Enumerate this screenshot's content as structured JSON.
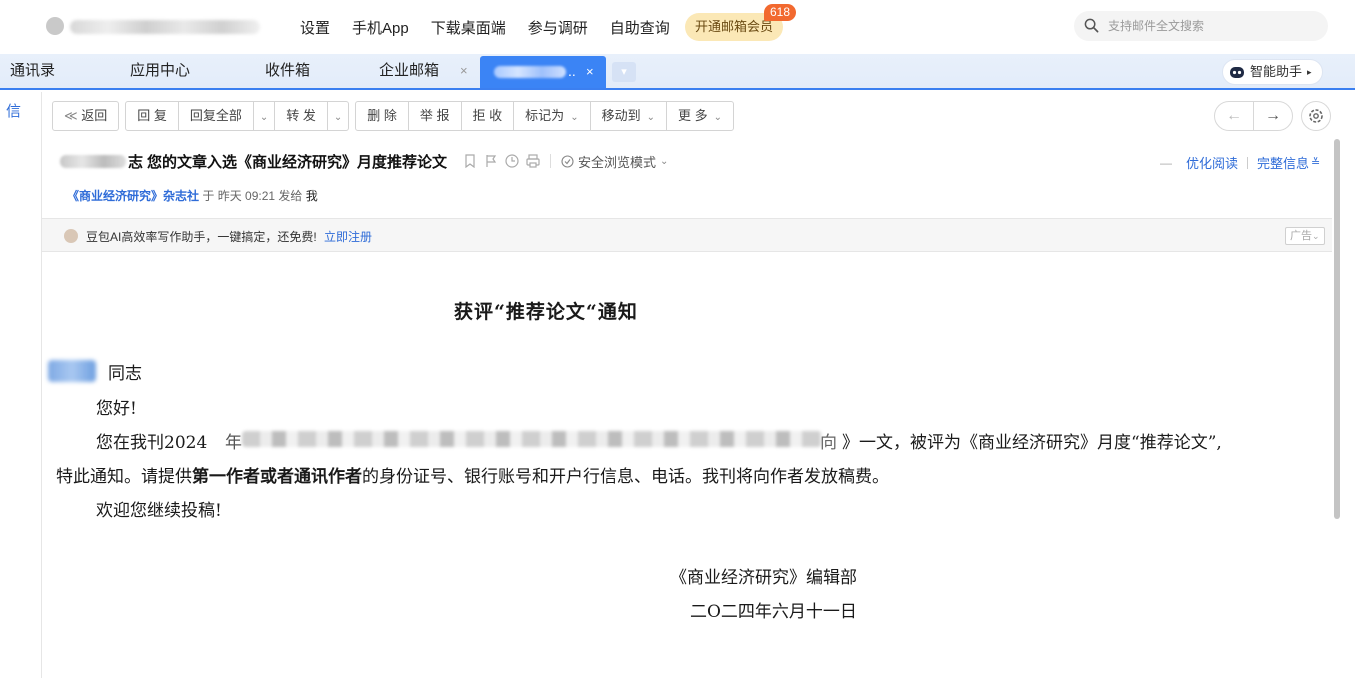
{
  "topbar": {
    "nav": [
      "设置",
      "手机App",
      "下载桌面端",
      "参与调研",
      "自助查询"
    ],
    "vip_label": "开通邮箱会员",
    "vip_badge": "618",
    "search_placeholder": "支持邮件全文搜索"
  },
  "tabs": {
    "items": [
      "通讯录",
      "应用中心",
      "收件箱",
      "企业邮箱"
    ],
    "active_suffix": "..",
    "close_glyph": "×",
    "assistant_label": "智能助手"
  },
  "sidebar": {
    "label": "信"
  },
  "toolbar": {
    "back": "返回",
    "reply": "回 复",
    "reply_all": "回复全部",
    "forward": "转 发",
    "delete": "删 除",
    "report": "举 报",
    "reject": "拒 收",
    "mark_as": "标记为",
    "move_to": "移动到",
    "more": "更 多"
  },
  "mail": {
    "subject_prefix_char": "志",
    "subject": "您的文章入选《商业经济研究》月度推荐论文",
    "safe_mode": "安全浏览模式",
    "optimize_read": "优化阅读",
    "full_info": "完整信息",
    "sender": "《商业经济研究》杂志社",
    "time_text": "于 昨天 09:21 发给",
    "recipient": "我",
    "ad_text": "豆包AI高效率写作助手，一键搞定，还免费!",
    "ad_link": "立即注册",
    "ad_tag": "广告",
    "body": {
      "title": "获评“推荐论文“通知",
      "salutation": "同志",
      "greeting": "您好!",
      "line1_start": "您在我刊2024",
      "line1_mid": "年",
      "line1_frag": "向",
      "line1_end": "》一文，被评为《商业经济研究》月度“推荐论文”,",
      "line2_a": "特此通知。请提供",
      "line2_bold": "第一作者或者通讯作者",
      "line2_b": "的身份证号、银行账号和开户行信息、电话。我刊将向作者发放稿费。",
      "line3": "欢迎您继续投稿!",
      "signature": "《商业经济研究》编辑部",
      "date": "二O二四年六月十一日"
    }
  },
  "colors": {
    "accent": "#3b84f5",
    "link": "#2f6cd8",
    "vip_bg": "#fbe8b6",
    "badge": "#f2692f"
  }
}
